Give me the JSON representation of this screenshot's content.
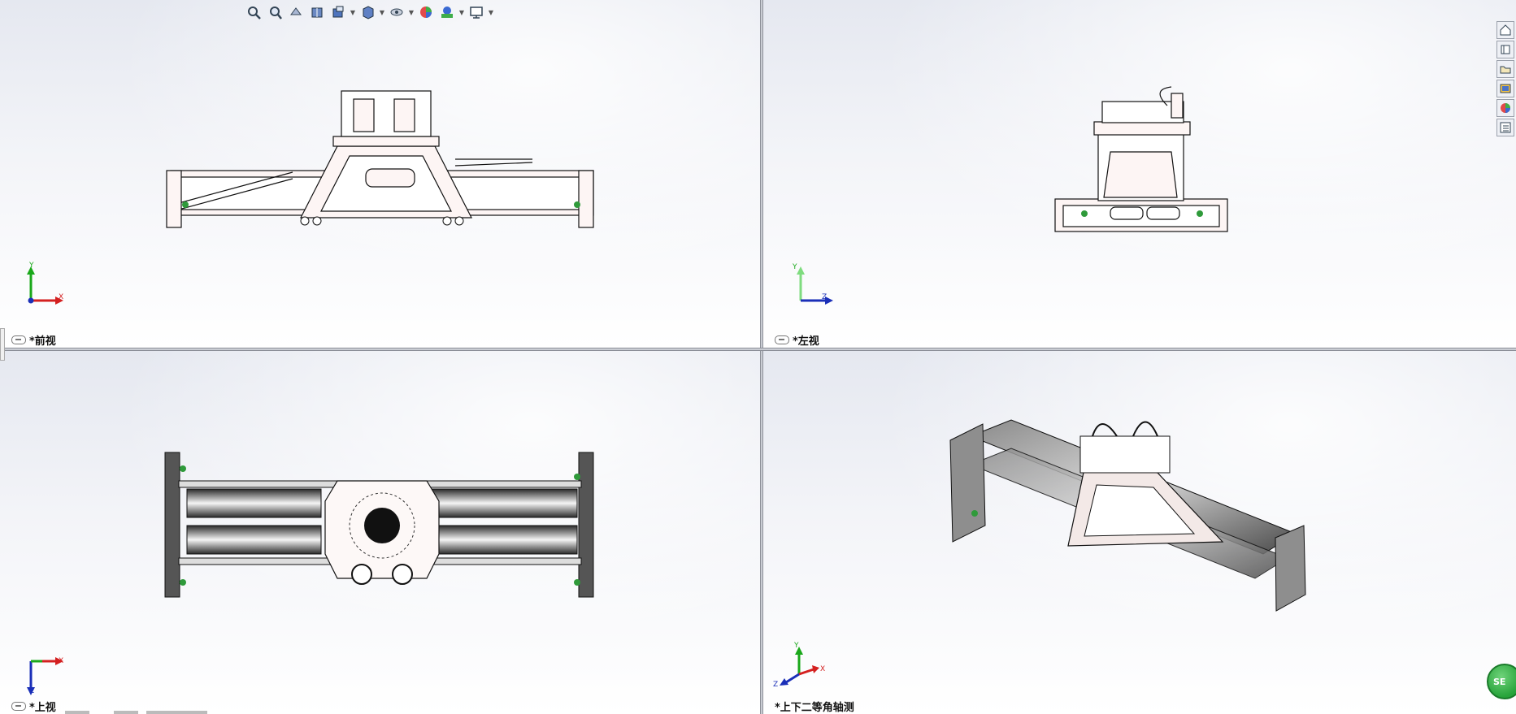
{
  "views": {
    "front": {
      "label": "*前视",
      "axes": {
        "up": "Y",
        "right": "X"
      }
    },
    "left": {
      "label": "*左视",
      "axes": {
        "up": "Y",
        "right": "Z"
      }
    },
    "top": {
      "label": "*上视",
      "axes": {
        "up": "X",
        "down": "Z"
      }
    },
    "iso": {
      "label": "*上下二等角轴测",
      "axes": {
        "up": "Y",
        "right": "X",
        "left": "Z"
      }
    }
  },
  "heads_up_toolbar": {
    "icons": [
      "zoom-to-fit-icon",
      "zoom-to-area-icon",
      "previous-view-icon",
      "section-view-icon",
      "dynamic-annotation-icon",
      "view-orientation-icon",
      "display-style-icon",
      "hide-show-icon",
      "edit-appearance-icon",
      "apply-scene-icon",
      "view-settings-icon"
    ]
  },
  "task_pane": {
    "icons": [
      "home-icon",
      "design-library-icon",
      "file-explorer-icon",
      "view-palette-icon",
      "appearances-icon",
      "custom-properties-icon"
    ]
  },
  "badge": {
    "text": "SE"
  },
  "colors": {
    "axis_x": "#d42020",
    "axis_y": "#1aa81a",
    "axis_z": "#1a2fb8",
    "accent_green": "#27a33a"
  }
}
